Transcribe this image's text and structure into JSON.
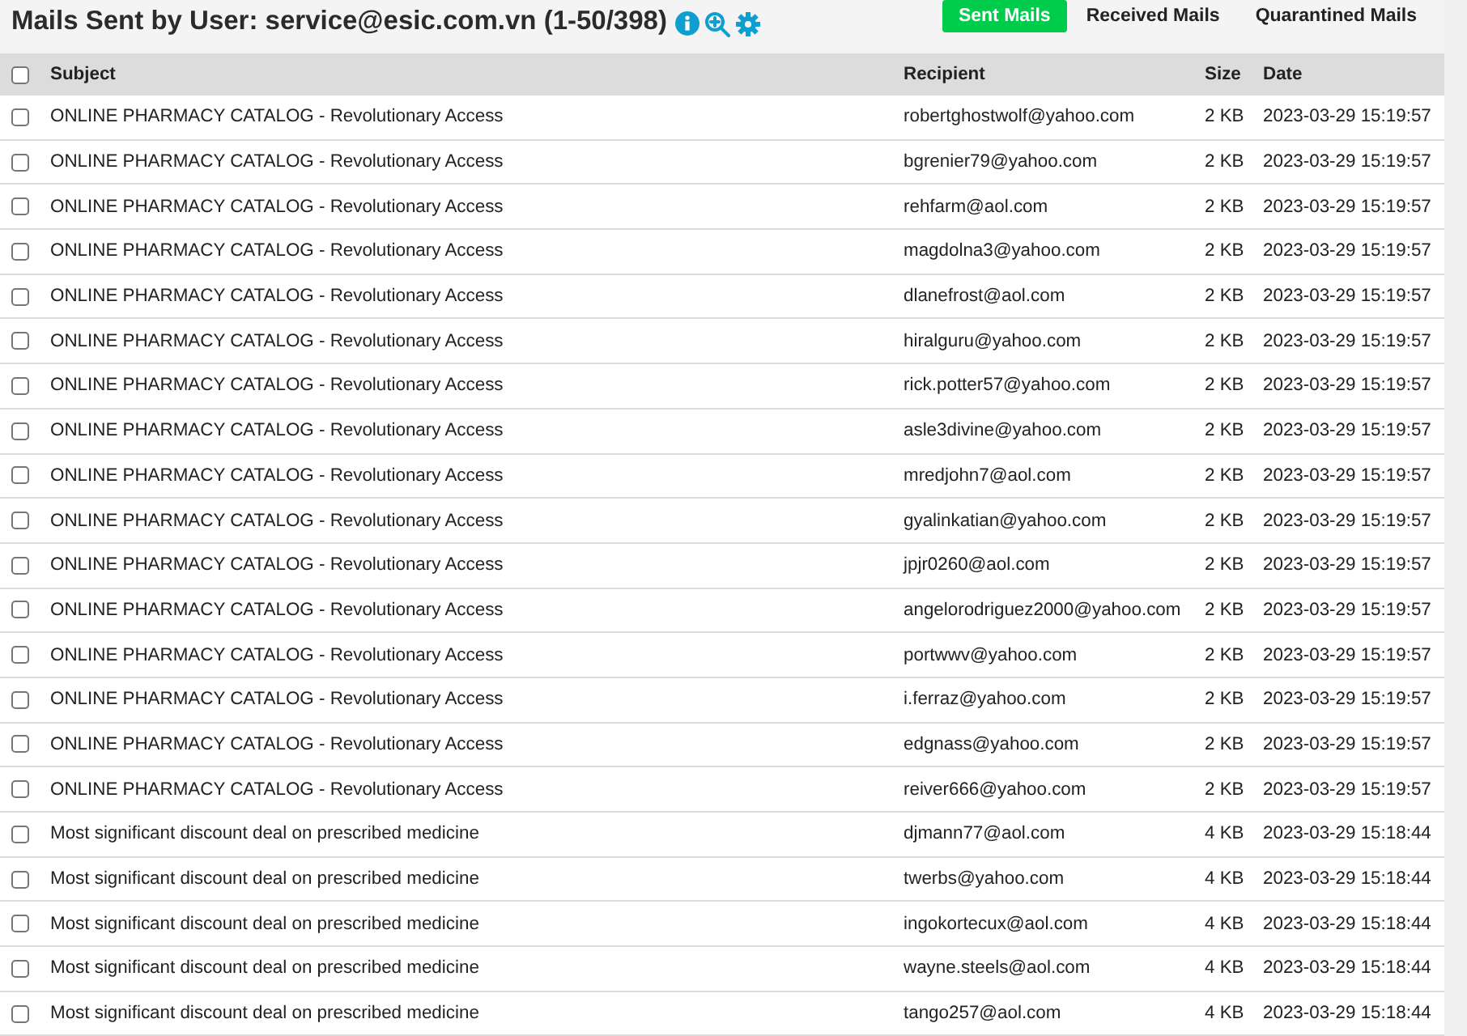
{
  "header": {
    "title": "Mails Sent by User: service@esic.com.vn (1-50/398)"
  },
  "tabs": [
    {
      "label": "Sent Mails",
      "selected": true
    },
    {
      "label": "Received Mails",
      "selected": false
    },
    {
      "label": "Quarantined Mails",
      "selected": false
    }
  ],
  "table": {
    "select_all": {
      "checked": false
    },
    "columns": [
      "Subject",
      "Recipient",
      "Size",
      "Date"
    ],
    "rows": [
      {
        "checked": false,
        "subject": "ONLINE PHARMACY CATALOG - Revolutionary Access",
        "recipient": "robertghostwolf@yahoo.com",
        "size": "2 KB",
        "date": "2023-03-29 15:19:57"
      },
      {
        "checked": false,
        "subject": "ONLINE PHARMACY CATALOG - Revolutionary Access",
        "recipient": "bgrenier79@yahoo.com",
        "size": "2 KB",
        "date": "2023-03-29 15:19:57"
      },
      {
        "checked": false,
        "subject": "ONLINE PHARMACY CATALOG - Revolutionary Access",
        "recipient": "rehfarm@aol.com",
        "size": "2 KB",
        "date": "2023-03-29 15:19:57"
      },
      {
        "checked": false,
        "subject": "ONLINE PHARMACY CATALOG - Revolutionary Access",
        "recipient": "magdolna3@yahoo.com",
        "size": "2 KB",
        "date": "2023-03-29 15:19:57"
      },
      {
        "checked": false,
        "subject": "ONLINE PHARMACY CATALOG - Revolutionary Access",
        "recipient": "dlanefrost@aol.com",
        "size": "2 KB",
        "date": "2023-03-29 15:19:57"
      },
      {
        "checked": false,
        "subject": "ONLINE PHARMACY CATALOG - Revolutionary Access",
        "recipient": "hiralguru@yahoo.com",
        "size": "2 KB",
        "date": "2023-03-29 15:19:57"
      },
      {
        "checked": false,
        "subject": "ONLINE PHARMACY CATALOG - Revolutionary Access",
        "recipient": "rick.potter57@yahoo.com",
        "size": "2 KB",
        "date": "2023-03-29 15:19:57"
      },
      {
        "checked": false,
        "subject": "ONLINE PHARMACY CATALOG - Revolutionary Access",
        "recipient": "asle3divine@yahoo.com",
        "size": "2 KB",
        "date": "2023-03-29 15:19:57"
      },
      {
        "checked": false,
        "subject": "ONLINE PHARMACY CATALOG - Revolutionary Access",
        "recipient": "mredjohn7@aol.com",
        "size": "2 KB",
        "date": "2023-03-29 15:19:57"
      },
      {
        "checked": false,
        "subject": "ONLINE PHARMACY CATALOG - Revolutionary Access",
        "recipient": "gyalinkatian@yahoo.com",
        "size": "2 KB",
        "date": "2023-03-29 15:19:57"
      },
      {
        "checked": false,
        "subject": "ONLINE PHARMACY CATALOG - Revolutionary Access",
        "recipient": "jpjr0260@aol.com",
        "size": "2 KB",
        "date": "2023-03-29 15:19:57"
      },
      {
        "checked": false,
        "subject": "ONLINE PHARMACY CATALOG - Revolutionary Access",
        "recipient": "angelorodriguez2000@yahoo.com",
        "size": "2 KB",
        "date": "2023-03-29 15:19:57"
      },
      {
        "checked": false,
        "subject": "ONLINE PHARMACY CATALOG - Revolutionary Access",
        "recipient": "portwwv@yahoo.com",
        "size": "2 KB",
        "date": "2023-03-29 15:19:57"
      },
      {
        "checked": false,
        "subject": "ONLINE PHARMACY CATALOG - Revolutionary Access",
        "recipient": "i.ferraz@yahoo.com",
        "size": "2 KB",
        "date": "2023-03-29 15:19:57"
      },
      {
        "checked": false,
        "subject": "ONLINE PHARMACY CATALOG - Revolutionary Access",
        "recipient": "edgnass@yahoo.com",
        "size": "2 KB",
        "date": "2023-03-29 15:19:57"
      },
      {
        "checked": false,
        "subject": "ONLINE PHARMACY CATALOG - Revolutionary Access",
        "recipient": "reiver666@yahoo.com",
        "size": "2 KB",
        "date": "2023-03-29 15:19:57"
      },
      {
        "checked": false,
        "subject": "Most significant discount deal on prescribed medicine",
        "recipient": "djmann77@aol.com",
        "size": "4 KB",
        "date": "2023-03-29 15:18:44"
      },
      {
        "checked": false,
        "subject": "Most significant discount deal on prescribed medicine",
        "recipient": "twerbs@yahoo.com",
        "size": "4 KB",
        "date": "2023-03-29 15:18:44"
      },
      {
        "checked": false,
        "subject": "Most significant discount deal on prescribed medicine",
        "recipient": "ingokortecux@aol.com",
        "size": "4 KB",
        "date": "2023-03-29 15:18:44"
      },
      {
        "checked": false,
        "subject": "Most significant discount deal on prescribed medicine",
        "recipient": "wayne.steels@aol.com",
        "size": "4 KB",
        "date": "2023-03-29 15:18:44"
      },
      {
        "checked": false,
        "subject": "Most significant discount deal on prescribed medicine",
        "recipient": "tango257@aol.com",
        "size": "4 KB",
        "date": "2023-03-29 15:18:44"
      }
    ]
  }
}
